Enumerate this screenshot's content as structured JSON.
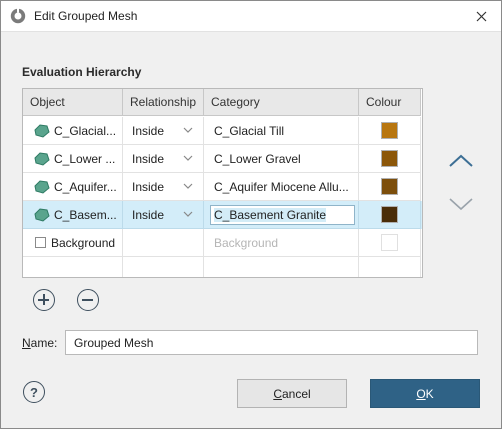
{
  "window": {
    "title": "Edit Grouped Mesh"
  },
  "section_label": "Evaluation Hierarchy",
  "table": {
    "headers": {
      "object": "Object",
      "relationship": "Relationship",
      "category": "Category",
      "colour": "Colour"
    },
    "rows": [
      {
        "object": "C_Glacial...",
        "relationship": "Inside",
        "category": "C_Glacial Till",
        "colour": "#b8760f"
      },
      {
        "object": "C_Lower ...",
        "relationship": "Inside",
        "category": "C_Lower Gravel",
        "colour": "#8c5709"
      },
      {
        "object": "C_Aquifer...",
        "relationship": "Inside",
        "category": "C_Aquifer Miocene Allu...",
        "colour": "#7c4e0b"
      },
      {
        "object": "C_Basem...",
        "relationship": "Inside",
        "category": "C_Basement Granite",
        "colour": "#4a2d08"
      }
    ],
    "background_row": {
      "object": "Background",
      "category": "Background"
    }
  },
  "name_field": {
    "label_prefix": "N",
    "label_rest": "ame:",
    "value": "Grouped Mesh"
  },
  "buttons": {
    "cancel_u": "C",
    "cancel_rest": "ancel",
    "ok_u": "O",
    "ok_rest": "K",
    "help": "?"
  },
  "colors": {
    "accent": "#2f6286",
    "selection": "#d3edf9",
    "mesh_icon": "#5aa48d"
  }
}
